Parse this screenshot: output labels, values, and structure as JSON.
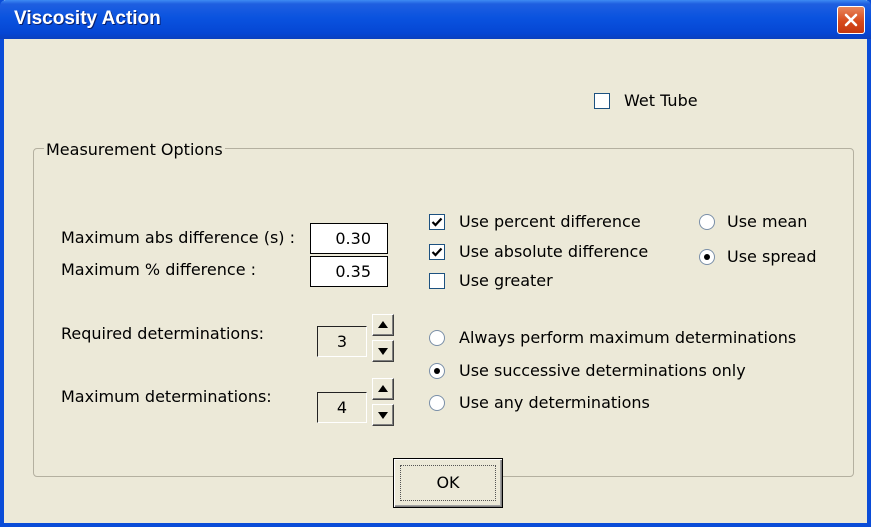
{
  "window": {
    "title": "Viscosity Action"
  },
  "wet_tube": {
    "label": "Wet Tube",
    "checked": false
  },
  "measurement_options": {
    "group_label": "Measurement Options",
    "max_abs_label": "Maximum abs difference (s) :",
    "max_abs_value": "0.30",
    "max_pct_label": "Maximum % difference :",
    "max_pct_value": "0.35",
    "use_percent": {
      "label": "Use percent difference",
      "checked": true
    },
    "use_absolute": {
      "label": "Use absolute difference",
      "checked": true
    },
    "use_greater": {
      "label": "Use greater",
      "checked": false
    },
    "use_mean": {
      "label": "Use mean",
      "selected": false
    },
    "use_spread": {
      "label": "Use spread",
      "selected": true
    },
    "required_label": "Required determinations:",
    "required_value": "3",
    "maximum_label": "Maximum determinations:",
    "maximum_value": "4",
    "always_max": {
      "label": "Always perform maximum determinations",
      "selected": false
    },
    "successive_only": {
      "label": "Use successive determinations only",
      "selected": true
    },
    "any_determinations": {
      "label": "Use any determinations",
      "selected": false
    }
  },
  "ok_button": {
    "label": "OK"
  },
  "icons": {
    "close": "close-icon",
    "check": "checkmark-icon",
    "spin_up": "arrow-up-icon",
    "spin_down": "arrow-down-icon"
  },
  "colors": {
    "titlebar": "#0a53df",
    "close": "#d74a1c",
    "dialog_bg": "#ece9d8"
  }
}
